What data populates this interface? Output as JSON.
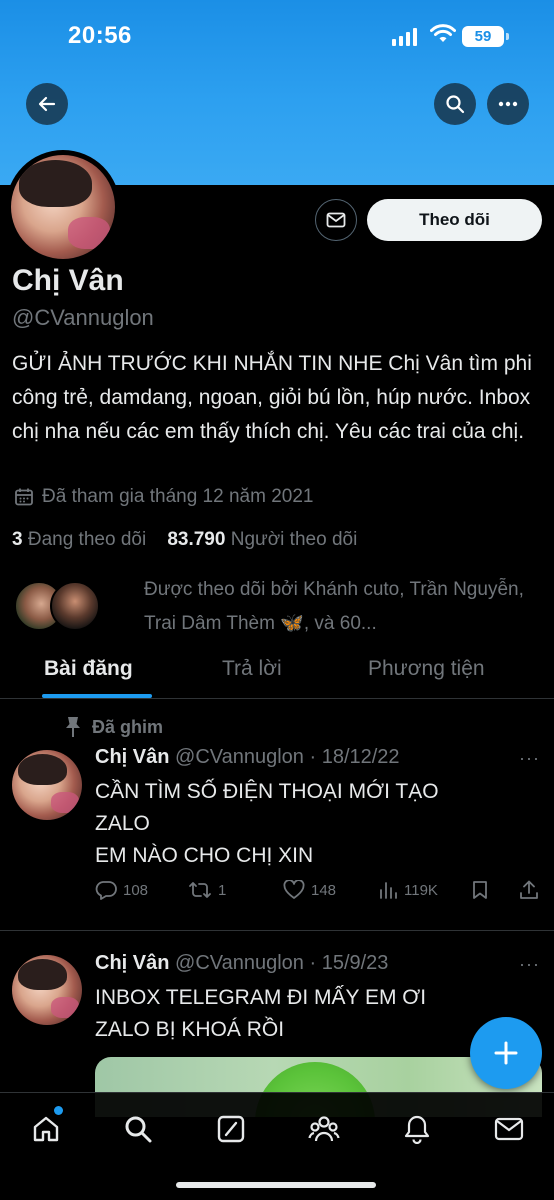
{
  "status_bar": {
    "time": "20:56",
    "battery": "59"
  },
  "profile": {
    "name": "Chị Vân",
    "handle": "@CVannuglon",
    "bio": "GỬI ẢNH TRƯỚC KHI NHẮN TIN NHE Chị Vân tìm phi công trẻ, damdang, ngoan, giỏi bú lồn, húp nước. Inbox chị nha nếu các em thấy thích chị. Yêu các trai của chị.",
    "joined": "Đã tham gia tháng 12 năm 2021",
    "following_count": "3",
    "following_label": "Đang theo dõi",
    "followers_count": "83.790",
    "followers_label": "Người theo dõi",
    "followed_by": "Được theo dõi bởi Khánh cuto, Trần Nguyễn, Trai Dâm Thèm 🦋, và 60..."
  },
  "actions": {
    "follow_label": "Theo dõi"
  },
  "tabs": [
    {
      "label": "Bài đăng",
      "active": true
    },
    {
      "label": "Trả lời",
      "active": false
    },
    {
      "label": "Phương tiện",
      "active": false
    }
  ],
  "pinned_label": "Đã ghim",
  "tweets": [
    {
      "name": "Chị Vân",
      "meta": "@CVannuglon · 18/12/22",
      "more": "···",
      "text_lines": [
        "CẦN TÌM SỐ ĐIỆN THOẠI MỚI TẠO",
        "ZALO",
        "EM NÀO CHO CHỊ XIN"
      ],
      "replies": "108",
      "retweets": "1",
      "likes": "148",
      "views": "119K"
    },
    {
      "name": "Chị Vân",
      "meta": "@CVannuglon · 15/9/23",
      "more": "···",
      "text_lines": [
        "INBOX TELEGRAM ĐI MẤY EM ƠI",
        "ZALO BỊ KHOÁ RỒI"
      ]
    }
  ],
  "icons": {
    "back": "back-arrow-icon",
    "search": "search-icon",
    "more": "more-icon",
    "message": "mail-icon",
    "calendar": "calendar-icon",
    "pin": "pin-icon",
    "fab": "plus-icon"
  },
  "colors": {
    "accent": "#1d9bf0",
    "banner": "#2da0f0",
    "muted": "#71767b"
  }
}
